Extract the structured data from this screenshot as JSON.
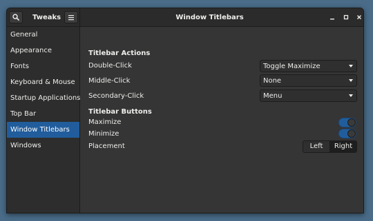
{
  "header": {
    "app_title": "Tweaks",
    "window_title": "Window Titlebars",
    "search_icon": "search-icon",
    "menu_icon": "hamburger-menu-icon"
  },
  "window_controls": [
    "minimize-icon",
    "maximize-icon",
    "close-icon"
  ],
  "sidebar": {
    "items": [
      {
        "label": "General",
        "selected": false
      },
      {
        "label": "Appearance",
        "selected": false
      },
      {
        "label": "Fonts",
        "selected": false
      },
      {
        "label": "Keyboard & Mouse",
        "selected": false
      },
      {
        "label": "Startup Applications",
        "selected": false
      },
      {
        "label": "Top Bar",
        "selected": false
      },
      {
        "label": "Window Titlebars",
        "selected": true
      },
      {
        "label": "Windows",
        "selected": false
      }
    ]
  },
  "titlebar_actions": {
    "heading": "Titlebar Actions",
    "double_click": {
      "label": "Double-Click",
      "value": "Toggle Maximize"
    },
    "middle_click": {
      "label": "Middle-Click",
      "value": "None"
    },
    "secondary_click": {
      "label": "Secondary-Click",
      "value": "Menu"
    }
  },
  "titlebar_buttons": {
    "heading": "Titlebar Buttons",
    "maximize": {
      "label": "Maximize",
      "enabled": true
    },
    "minimize": {
      "label": "Minimize",
      "enabled": true
    },
    "placement": {
      "label": "Placement",
      "options": [
        "Left",
        "Right"
      ],
      "selected": "Right"
    }
  },
  "colors": {
    "accent": "#215d9c",
    "window_bg": "#353535",
    "sidebar_bg": "#2d2d2d",
    "desktop_bg": "#4a6c89"
  }
}
